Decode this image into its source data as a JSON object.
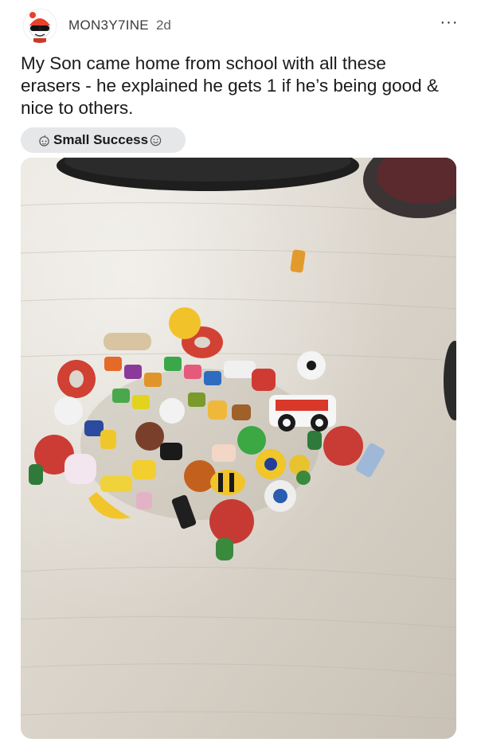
{
  "post": {
    "username": "MON3Y7INE",
    "age": "2d",
    "more_label": "···",
    "title": "My Son came home from school with all these erasers - he explained he gets 1 if he’s being good & nice to others.",
    "flair": {
      "label": "Small Success",
      "icon_left": "robot-face-icon",
      "icon_right": "smiley-face-icon"
    }
  },
  "colors": {
    "flair_bg": "#e6e7e9",
    "text": "#1a1a1b",
    "meta": "#5f5f63"
  }
}
